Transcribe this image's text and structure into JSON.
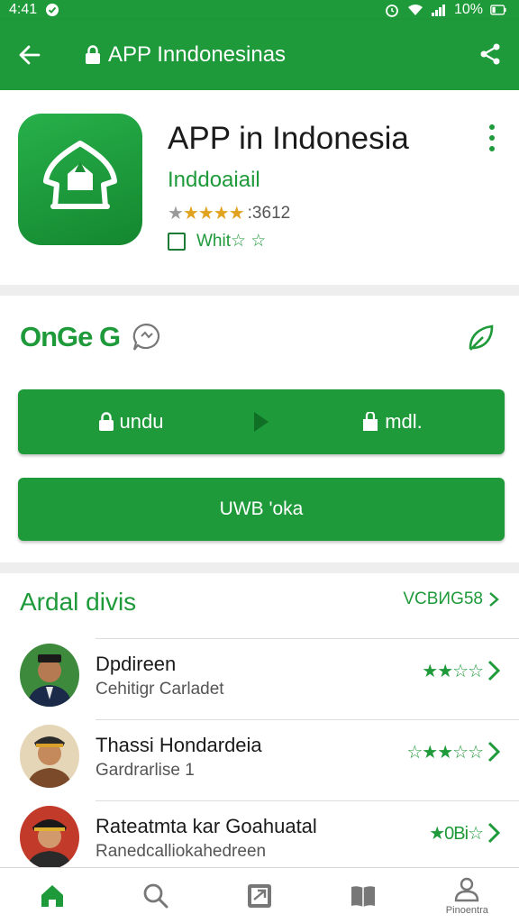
{
  "status_bar": {
    "time": "4:41",
    "battery": "10%"
  },
  "app_bar": {
    "title": "APP Inndonesinas",
    "back_icon": "arrow-back-icon",
    "share_icon": "share-icon"
  },
  "app": {
    "name": "APP in Indonesia",
    "developer": "Inddoaiail",
    "rating_stars": 4,
    "rating_count": ":3612",
    "wishlist_label": "Whit☆ ☆",
    "icon": "app-logo-icon"
  },
  "install": {
    "status_label": "OnGe G",
    "install_label": "undu",
    "update_label": "mdl.",
    "open_label": "UWB 'oka"
  },
  "reviews": {
    "title": "Ardal divis",
    "see_all": "VCBИG58",
    "items": [
      {
        "name": "Dpdireen",
        "subtitle": "Cehitigr Carladet",
        "stars": "★★☆☆"
      },
      {
        "name": "Thassi Hondardeia",
        "subtitle": "Gardrarlise 1",
        "stars": "☆★★☆☆"
      },
      {
        "name": "Rateatmta kar Goahuatal",
        "subtitle": "Ranedcalliokahedreen",
        "stars": "★0Bi☆"
      }
    ]
  },
  "bottom_nav": {
    "items": [
      {
        "icon": "home-icon",
        "label": ""
      },
      {
        "icon": "search-icon",
        "label": ""
      },
      {
        "icon": "library-icon",
        "label": ""
      },
      {
        "icon": "book-icon",
        "label": ""
      },
      {
        "icon": "profile-icon",
        "label": "Pinoentra"
      }
    ]
  },
  "colors": {
    "primary": "#1f9a3a",
    "star": "#e0a21f"
  }
}
